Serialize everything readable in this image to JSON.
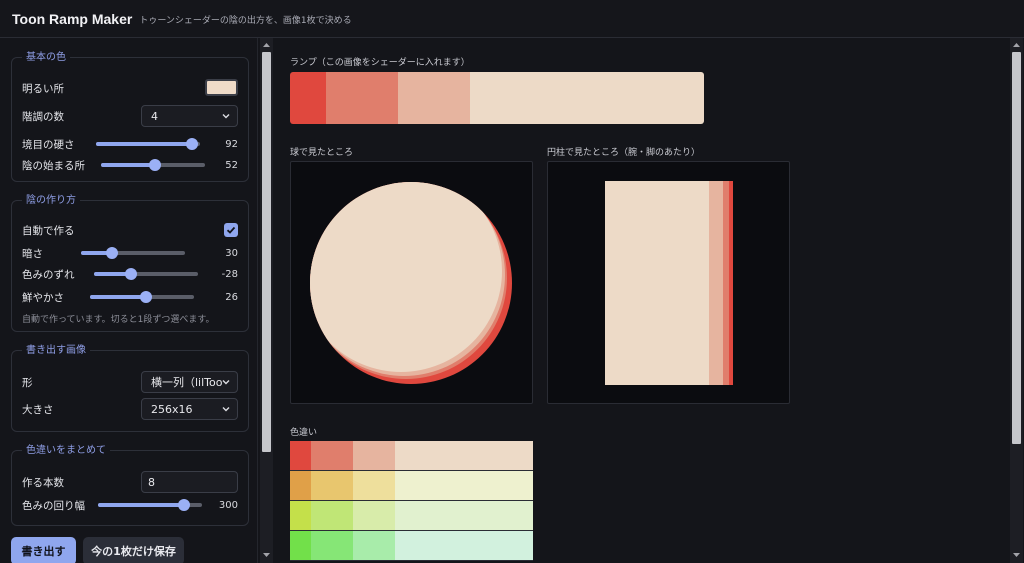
{
  "header": {
    "title": "Toon Ramp Maker",
    "subtitle": "トゥーンシェーダーの陰の出方を、画像1枚で決める"
  },
  "sidebar": {
    "base": {
      "title": "基本の色",
      "highlight_label": "明るい所",
      "highlight_color": "#efdbc8",
      "steps_label": "階調の数",
      "steps_value": "4",
      "hardness_label": "境目の硬さ",
      "hardness_value": "92",
      "shadow_start_label": "陰の始まる所",
      "shadow_start_value": "52"
    },
    "shadow": {
      "title": "陰の作り方",
      "auto_label": "自動で作る",
      "auto_checked": true,
      "darkness_label": "暗さ",
      "darkness_value": "30",
      "hue_shift_label": "色みのずれ",
      "hue_shift_value": "-28",
      "saturation_label": "鮮やかさ",
      "saturation_value": "26",
      "hint": "自動で作っています。切ると1段ずつ選べます。"
    },
    "export": {
      "title": "書き出す画像",
      "shape_label": "形",
      "shape_value": "横一列（lilToo",
      "size_label": "大きさ",
      "size_value": "256x16"
    },
    "batch": {
      "title": "色違いをまとめて",
      "count_label": "作る本数",
      "count_value": "8",
      "hue_range_label": "色みの回り幅",
      "hue_range_value": "300"
    },
    "buttons": {
      "export": "書き出す",
      "save_one": "今の1枚だけ保存"
    }
  },
  "sliders": {
    "hardness": 0.92,
    "shadow_start": 0.52,
    "darkness": 0.3,
    "hue_shift": 0.36,
    "saturation": 0.54,
    "hue_range": 0.83
  },
  "main": {
    "ramp_caption": "ランプ（この画像をシェーダーに入れます）",
    "ramp_colors": [
      "#e0483e",
      "#e07e6c",
      "#e6b49f",
      "#eddac7"
    ],
    "sphere_caption": "球で見たところ",
    "cylinder_caption": "円柱で見たところ（腕・脚のあたり）",
    "variants_caption": "色違い",
    "variants": [
      [
        "#e0483e",
        "#e07e6c",
        "#e6b49f",
        "#eddac7"
      ],
      [
        "#e0a048",
        "#e8c66e",
        "#eedf9c",
        "#eef1cf"
      ],
      [
        "#c4e04a",
        "#c0e676",
        "#d8ecaa",
        "#e1f1cf"
      ],
      [
        "#72e04a",
        "#86e676",
        "#a8ecaa",
        "#d2f1de"
      ]
    ]
  }
}
